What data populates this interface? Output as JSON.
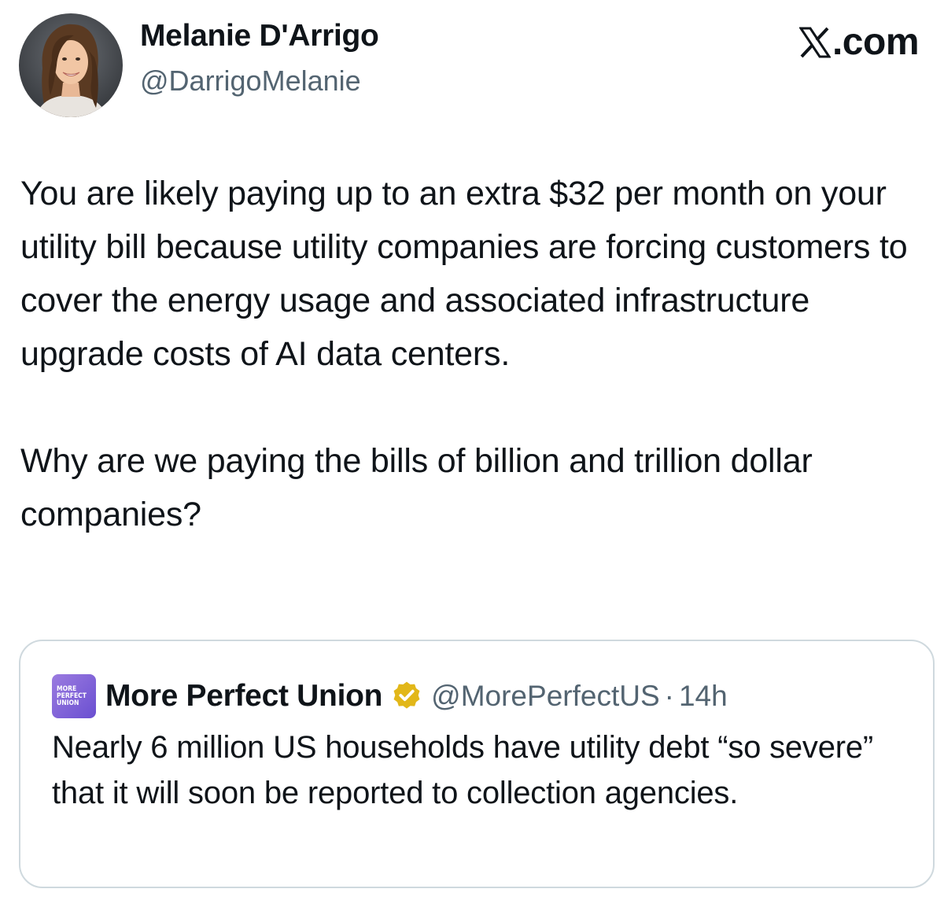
{
  "author": {
    "name": "Melanie D'Arrigo",
    "handle": "@DarrigoMelanie",
    "avatar_icon": "profile-photo"
  },
  "source": {
    "label": ".com",
    "logo_icon": "x-logo-icon"
  },
  "tweet": {
    "paragraphs": [
      "You are likely paying up to an extra $32 per month on your utility bill because utility companies are forcing customers to cover the energy usage and associated infrastructure upgrade costs of AI data centers.",
      "Why are we paying the bills of billion and trillion dollar companies?"
    ]
  },
  "quoted_tweet": {
    "logo_lines": [
      "MORE",
      "PERFECT",
      "UNION"
    ],
    "name": "More Perfect Union",
    "verified_icon": "verified-badge-icon",
    "verified_color": "#e2b719",
    "handle": "@MorePerfectUS",
    "separator": "·",
    "time": "14h",
    "text": "Nearly 6 million US households have utility debt “so severe” that it will soon be reported to collection agencies."
  },
  "colors": {
    "text_primary": "#0f1419",
    "text_secondary": "#536471",
    "card_border": "#cfd9de",
    "logo_purple": "#7b5cd6"
  }
}
